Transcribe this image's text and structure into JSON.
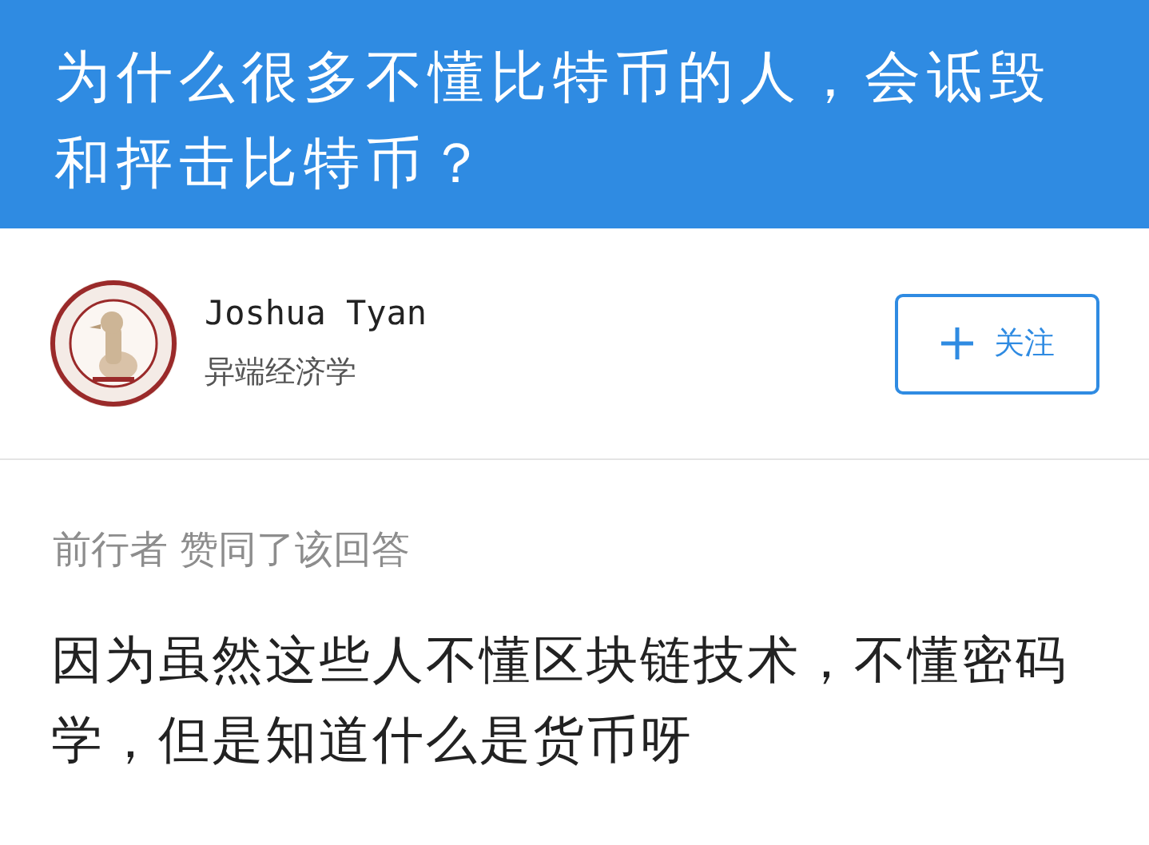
{
  "question": {
    "title": "为什么很多不懂比特币的人，会诋毁和抨击比特币？"
  },
  "author": {
    "name": "Joshua Tyan",
    "bio": "异端经济学"
  },
  "follow_button": {
    "label": "关注"
  },
  "activity": {
    "text": "前行者 赞同了该回答"
  },
  "answer": {
    "text": "因为虽然这些人不懂区块链技术，不懂密码学，但是知道什么是货币呀"
  }
}
